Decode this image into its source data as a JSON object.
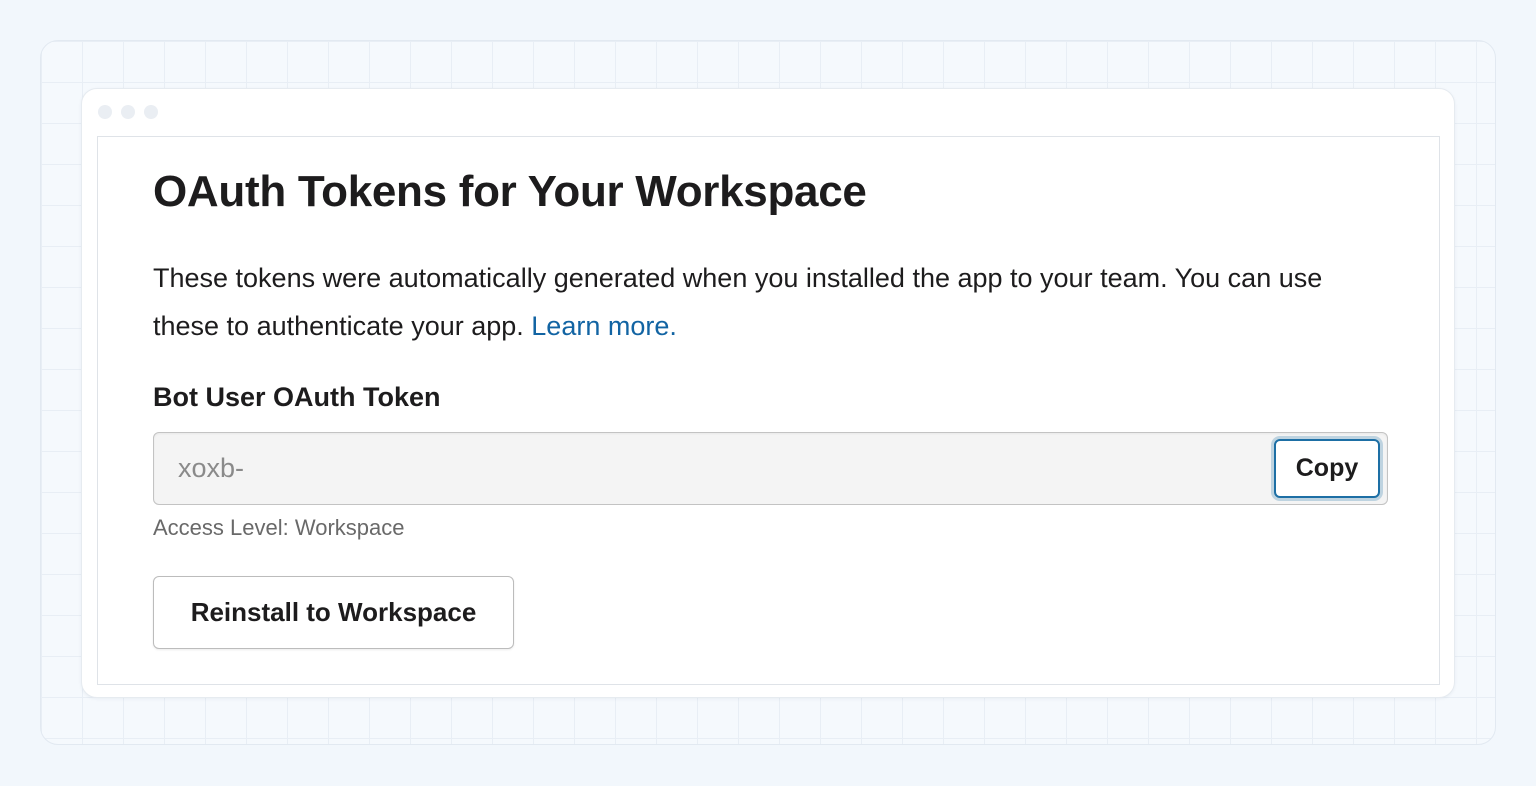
{
  "page": {
    "title": "OAuth Tokens for Your Workspace",
    "description_text": "These tokens were automatically generated when you installed the app to your team. You can use these to authenticate your app.",
    "learn_more_label": "Learn more."
  },
  "bot_token": {
    "label": "Bot User OAuth Token",
    "value": "xoxb-",
    "copy_label": "Copy",
    "access_level": "Access Level: Workspace"
  },
  "actions": {
    "reinstall_label": "Reinstall to Workspace"
  },
  "colors": {
    "link": "#1264a3",
    "text": "#1d1c1d",
    "focus_ring": "#1d6fa5",
    "background": "#f2f7fc"
  }
}
